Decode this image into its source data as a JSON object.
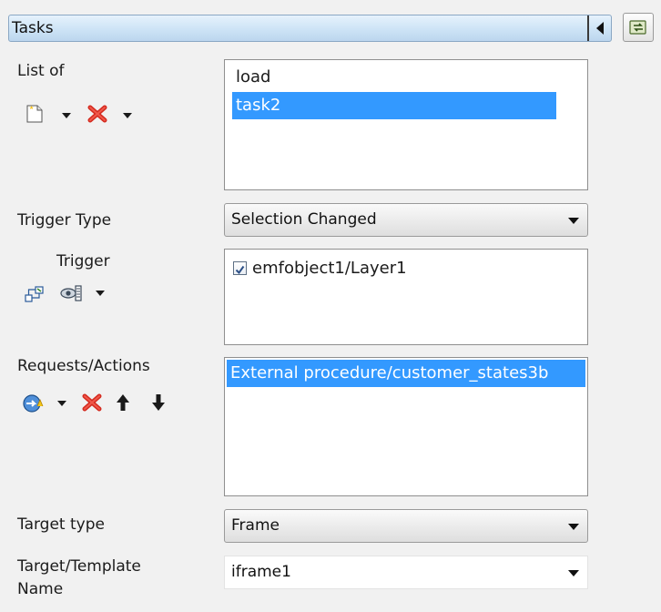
{
  "panel": {
    "title": "Tasks"
  },
  "list_of": {
    "label": "List of",
    "items": [
      "load",
      "task2"
    ],
    "selected_index": 1
  },
  "trigger_type": {
    "label": "Trigger Type",
    "value": "Selection Changed"
  },
  "trigger": {
    "label": "Trigger",
    "items": [
      {
        "label": "emfobject1/Layer1",
        "checked": true
      }
    ]
  },
  "requests_actions": {
    "label": "Requests/Actions",
    "items": [
      "External procedure/customer_states3b"
    ],
    "selected_index": 0
  },
  "target_type": {
    "label": "Target type",
    "value": "Frame"
  },
  "target_template": {
    "label_line1": "Target/Template",
    "label_line2": "Name",
    "value": "iframe1"
  },
  "colors": {
    "selection": "#3399ff",
    "titlebar": "#cde3f6",
    "delete_red": "#d42a1f"
  }
}
